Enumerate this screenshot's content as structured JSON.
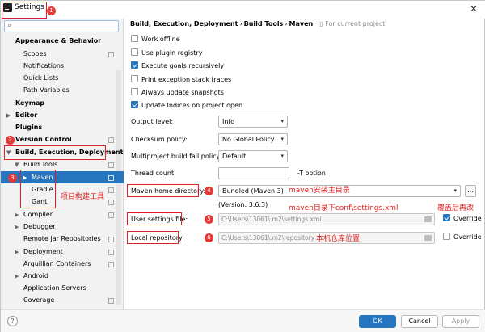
{
  "window": {
    "title": "Settings",
    "close": "✕"
  },
  "search": {
    "placeholder": "",
    "icon": "search-icon"
  },
  "sidebar": {
    "appearance": "Appearance & Behavior",
    "scopes": "Scopes",
    "notifications": "Notifications",
    "quick_lists": "Quick Lists",
    "path_variables": "Path Variables",
    "keymap": "Keymap",
    "editor": "Editor",
    "plugins": "Plugins",
    "version_control": "Version Control",
    "build": "Build, Execution, Deployment",
    "build_tools": "Build Tools",
    "maven": "Maven",
    "gradle": "Gradle",
    "gant": "Gant",
    "compiler": "Compiler",
    "debugger": "Debugger",
    "remote_jar": "Remote Jar Repositories",
    "deployment": "Deployment",
    "arquillian": "Arquillian Containers",
    "android": "Android",
    "app_servers": "Application Servers",
    "coverage": "Coverage"
  },
  "breadcrumb": {
    "part1": "Build, Execution, Deployment",
    "part2": "Build Tools",
    "part3": "Maven",
    "sep": "›",
    "for_current": "For current project"
  },
  "options": {
    "work_offline": "Work offline",
    "use_plugin_registry": "Use plugin registry",
    "execute_goals": "Execute goals recursively",
    "print_exception": "Print exception stack traces",
    "always_update": "Always update snapshots",
    "update_indices": "Update Indices on project open"
  },
  "fields": {
    "output_level_label": "Output level:",
    "output_level_value": "Info",
    "checksum_label": "Checksum policy:",
    "checksum_value": "No Global Policy",
    "multiproject_label": "Multiproject build fail policy:",
    "multiproject_value": "Default",
    "thread_count_label": "Thread count",
    "thread_count_suffix": "-T option",
    "maven_home_label": "Maven home directory:",
    "maven_home_value": "Bundled (Maven 3)",
    "browse": "...",
    "version": "(Version: 3.6.3)",
    "user_settings_label": "User settings file:",
    "user_settings_value": "C:\\Users\\13061\\.m2\\settings.xml",
    "override": "Override",
    "local_repo_label": "Local repository:",
    "local_repo_value": "C:\\Users\\13061\\.m2\\repository"
  },
  "annotations": {
    "n1": "1",
    "n2": "2",
    "n3": "3",
    "n4": "4",
    "n5": "5",
    "n6": "6",
    "build_tools_cn": "项目构建工具",
    "maven_home_cn": "maven安装主目录",
    "settings_cn": "maven目录下conf\\settings.xml",
    "override_cn": "覆盖后再改",
    "repo_cn": "本机仓库位置"
  },
  "buttons": {
    "help": "?",
    "ok": "OK",
    "cancel": "Cancel",
    "apply": "Apply"
  },
  "colors": {
    "accent": "#2675bf",
    "annotation": "#e02020"
  }
}
